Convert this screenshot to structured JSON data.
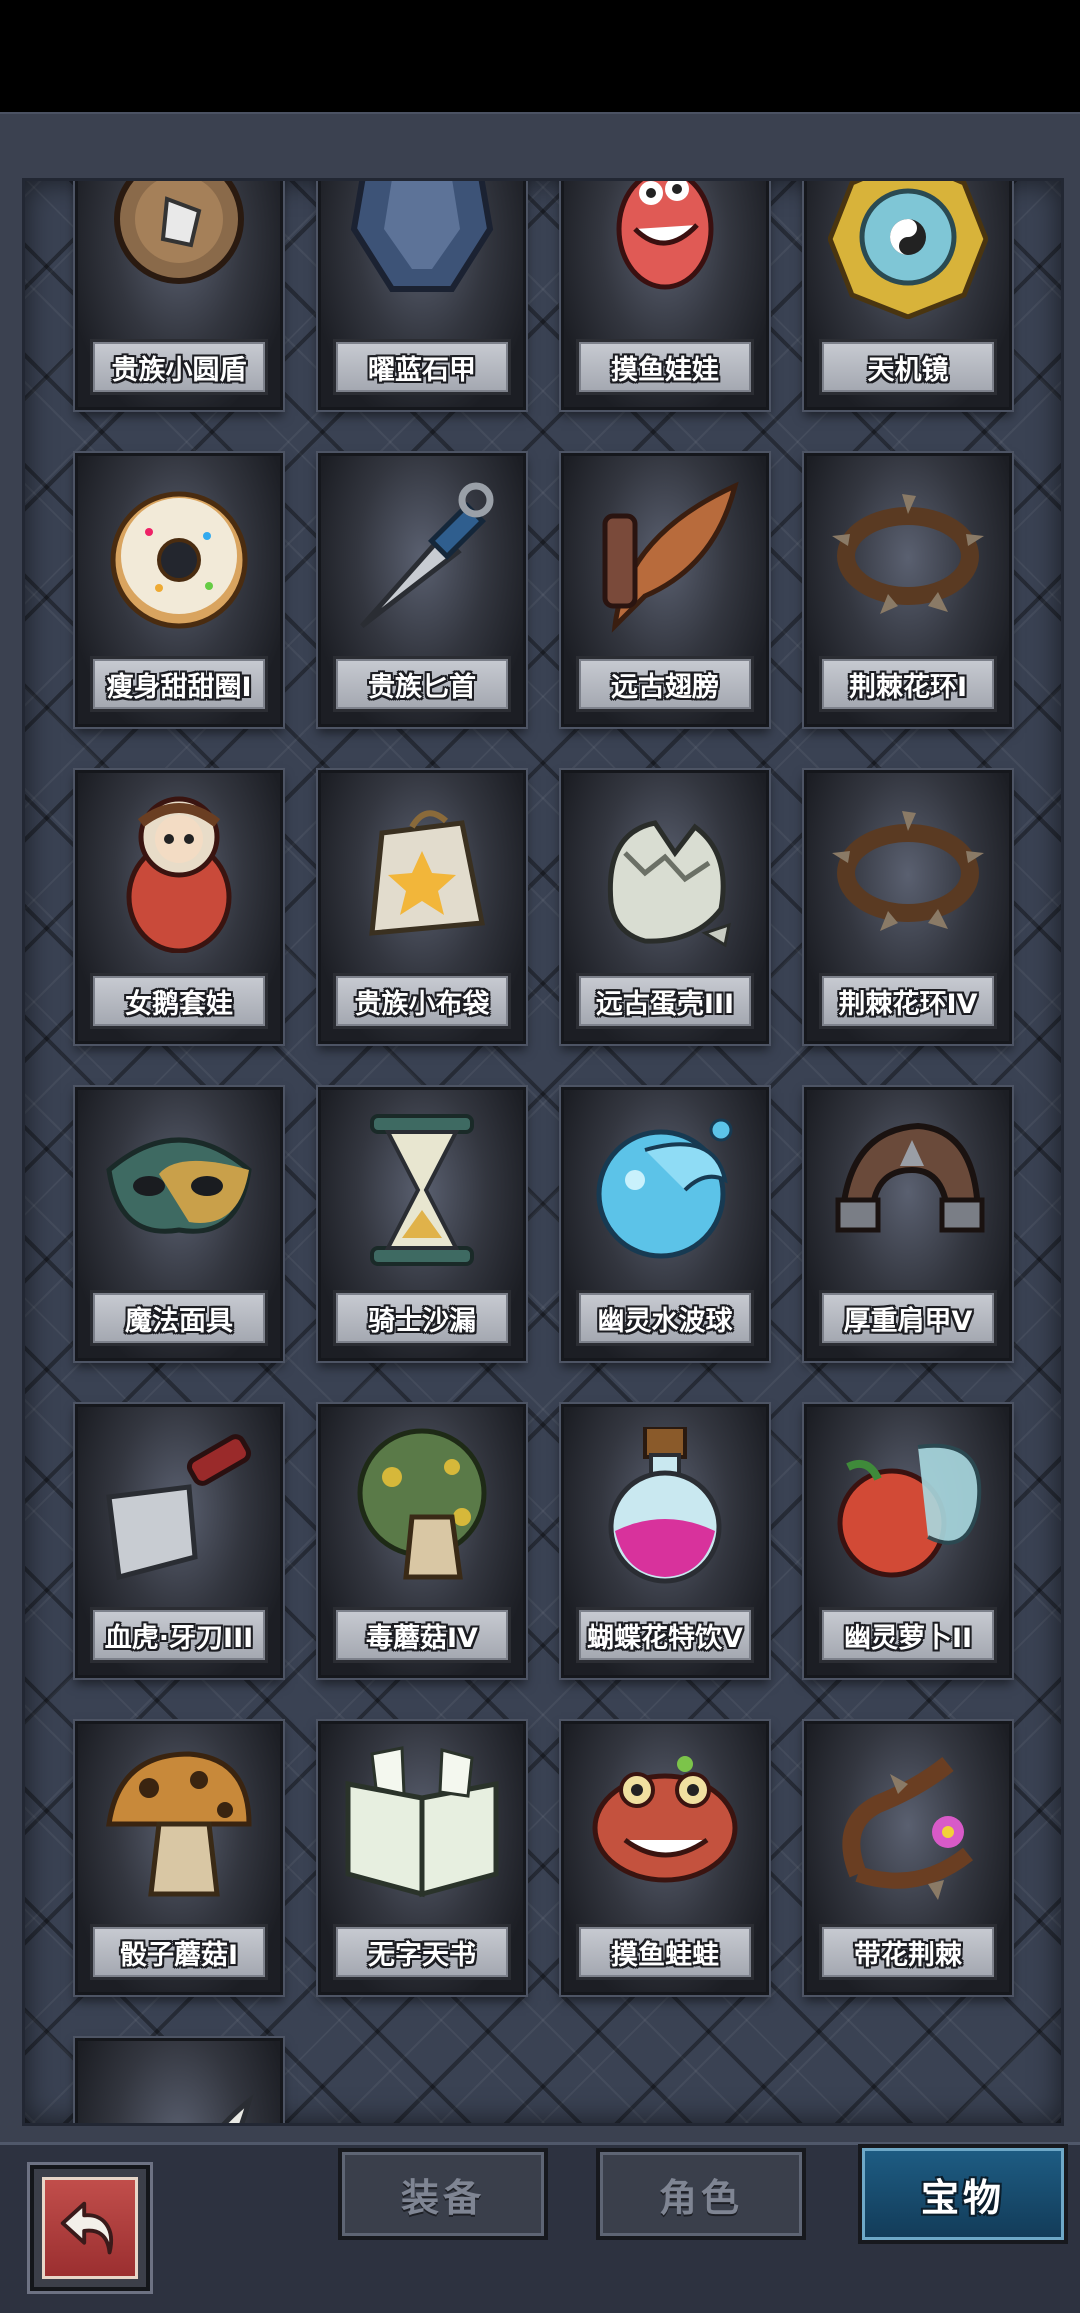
{
  "items": [
    {
      "name": "贵族小圆盾",
      "icon": "round-shield-icon"
    },
    {
      "name": "曜蓝石甲",
      "icon": "blue-armor-icon"
    },
    {
      "name": "摸鱼娃娃",
      "icon": "fish-doll-icon"
    },
    {
      "name": "天机镜",
      "icon": "bagua-mirror-icon"
    },
    {
      "name": "瘦身甜甜圈I",
      "icon": "donut-icon"
    },
    {
      "name": "贵族匕首",
      "icon": "dagger-icon"
    },
    {
      "name": "远古翅膀",
      "icon": "ancient-wing-icon"
    },
    {
      "name": "荆棘花环I",
      "icon": "thorn-wreath-icon"
    },
    {
      "name": "女鹅套娃",
      "icon": "nesting-doll-icon"
    },
    {
      "name": "贵族小布袋",
      "icon": "cloth-bag-icon"
    },
    {
      "name": "远古蛋壳III",
      "icon": "eggshell-icon"
    },
    {
      "name": "荆棘花环IV",
      "icon": "thorn-wreath-icon"
    },
    {
      "name": "魔法面具",
      "icon": "magic-mask-icon"
    },
    {
      "name": "骑士沙漏",
      "icon": "hourglass-icon"
    },
    {
      "name": "幽灵水波球",
      "icon": "water-orb-icon"
    },
    {
      "name": "厚重肩甲V",
      "icon": "shoulder-armor-icon"
    },
    {
      "name": "血虎·牙刀III",
      "icon": "cleaver-icon"
    },
    {
      "name": "毒蘑菇IV",
      "icon": "poison-mushroom-icon"
    },
    {
      "name": "蝴蝶花特饮V",
      "icon": "potion-icon"
    },
    {
      "name": "幽灵萝卜II",
      "icon": "ghost-radish-icon"
    },
    {
      "name": "骰子蘑菇I",
      "icon": "dice-mushroom-icon"
    },
    {
      "name": "无字天书",
      "icon": "blank-book-icon"
    },
    {
      "name": "摸鱼蛙蛙",
      "icon": "fish-frog-icon"
    },
    {
      "name": "带花荆棘",
      "icon": "flower-thorn-icon"
    },
    {
      "name": "",
      "icon": "horn-icon"
    }
  ],
  "tabs": [
    {
      "label": "装备",
      "active": false
    },
    {
      "label": "角色",
      "active": false
    },
    {
      "label": "宝物",
      "active": true
    }
  ],
  "colors": {
    "panel": "#3b4150",
    "tab_active": "#1e5d84",
    "back_button": "#c14e4b"
  }
}
